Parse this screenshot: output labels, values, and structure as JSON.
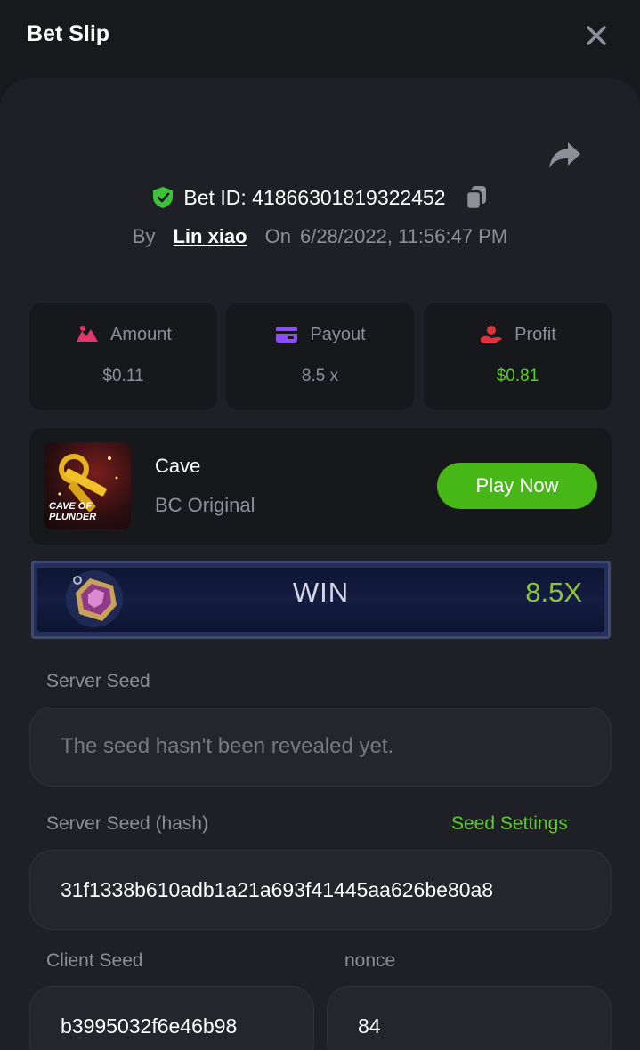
{
  "header": {
    "title": "Bet Slip"
  },
  "bet": {
    "id_label": "Bet ID: 41866301819322452",
    "by_label": "By",
    "user": "Lin xiao",
    "on_label": "On",
    "datetime": "6/28/2022, 11:56:47 PM"
  },
  "stats": {
    "amount": {
      "label": "Amount",
      "value": "$0.11"
    },
    "payout": {
      "label": "Payout",
      "value": "8.5 x"
    },
    "profit": {
      "label": "Profit",
      "value": "$0.81",
      "color": "#5ccd2a"
    }
  },
  "game": {
    "name": "Cave",
    "provider": "BC Original",
    "thumb_text": "CAVE OF PLUNDER",
    "play_label": "Play Now"
  },
  "result": {
    "label": "WIN",
    "multiplier": "8.5X"
  },
  "seeds": {
    "server_seed_label": "Server Seed",
    "server_seed_placeholder": "The seed hasn't been revealed yet.",
    "server_hash_label": "Server Seed (hash)",
    "seed_settings_label": "Seed Settings",
    "server_hash_value": "31f1338b610adb1a21a693f41445aa626be80a8",
    "client_seed_label": "Client Seed",
    "client_seed_value": "b3995032f6e46b98",
    "nonce_label": "nonce",
    "nonce_value": "84"
  },
  "colors": {
    "accent_green": "#47b617",
    "profit_green": "#5ccd2a",
    "amount_icon": "#e8336a",
    "payout_icon": "#8a4dff",
    "profit_icon": "#e0333c"
  }
}
